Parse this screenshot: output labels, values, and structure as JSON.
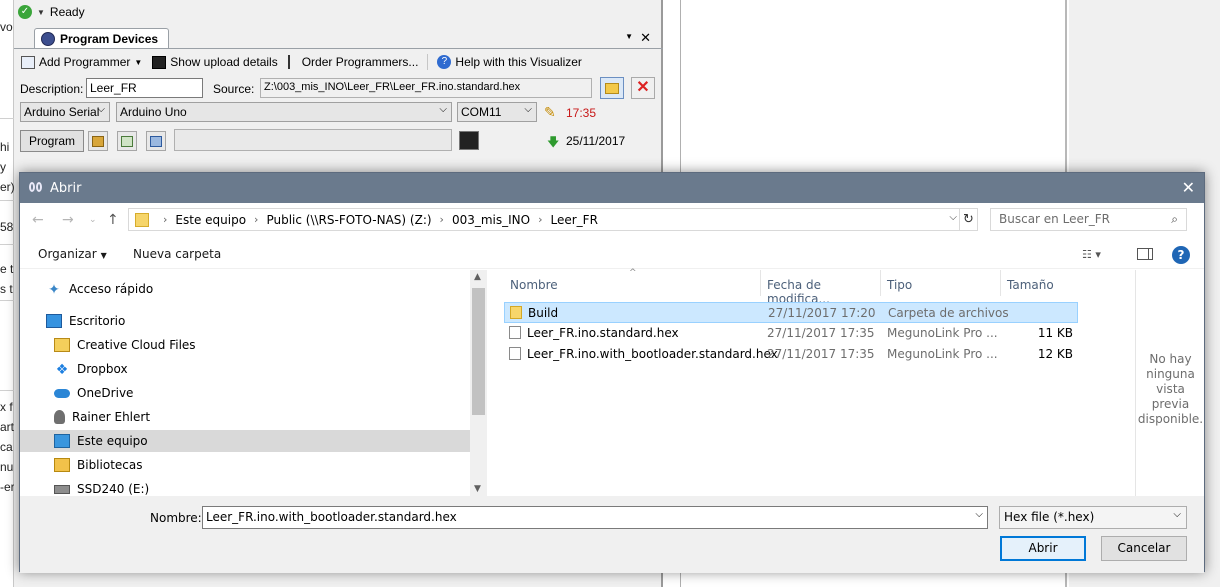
{
  "background": {
    "left_fragments": [
      "vo",
      "hi",
      "y",
      "er)",
      "58",
      "e t",
      "s t",
      "x f",
      "art",
      "ca",
      "nu",
      "-er"
    ],
    "status": "Ready",
    "panel_tab": "Program Devices",
    "toolbar": {
      "add_programmer": "Add Programmer",
      "show_upload": "Show upload details",
      "order_programmers": "Order Programmers...",
      "help": "Help with this Visualizer"
    },
    "description_label": "Description:",
    "description_value": "Leer_FR",
    "source_label": "Source:",
    "source_value": "Z:\\003_mis_INO\\Leer_FR\\Leer_FR.ino.standard.hex",
    "programmer_type": "Arduino Serial",
    "board": "Arduino Uno",
    "port": "COM11",
    "time": "17:35",
    "program_button": "Program",
    "date": "25/11/2017"
  },
  "dialog": {
    "title": "Abrir",
    "breadcrumb": [
      "Este equipo",
      "Public (\\\\RS-FOTO-NAS) (Z:)",
      "003_mis_INO",
      "Leer_FR"
    ],
    "search_placeholder": "Buscar en Leer_FR",
    "organize": "Organizar",
    "new_folder": "Nueva carpeta",
    "nav_items": [
      {
        "label": "Acceso rápido",
        "icon": "star-icon"
      },
      {
        "label": "Escritorio",
        "icon": "desktop-icon"
      },
      {
        "label": "Creative Cloud Files",
        "icon": "creative-cloud-icon"
      },
      {
        "label": "Dropbox",
        "icon": "dropbox-icon"
      },
      {
        "label": "OneDrive",
        "icon": "onedrive-icon"
      },
      {
        "label": "Rainer Ehlert",
        "icon": "user-icon"
      },
      {
        "label": "Este equipo",
        "icon": "computer-icon"
      },
      {
        "label": "Bibliotecas",
        "icon": "libraries-icon"
      },
      {
        "label": "SSD240 (E:)",
        "icon": "drive-icon"
      }
    ],
    "columns": [
      "Nombre",
      "Fecha de modifica...",
      "Tipo",
      "Tamaño"
    ],
    "files": [
      {
        "name": "Build",
        "date": "27/11/2017 17:20",
        "type": "Carpeta de archivos",
        "size": ""
      },
      {
        "name": "Leer_FR.ino.standard.hex",
        "date": "27/11/2017 17:35",
        "type": "MegunoLink Pro ...",
        "size": "11 KB"
      },
      {
        "name": "Leer_FR.ino.with_bootloader.standard.hex",
        "date": "27/11/2017 17:35",
        "type": "MegunoLink Pro ...",
        "size": "12 KB"
      }
    ],
    "preview_text": "No hay ninguna vista previa disponible.",
    "filename_label": "Nombre:",
    "filename_value": "Leer_FR.ino.with_bootloader.standard.hex",
    "filter_value": "Hex file (*.hex)",
    "open_button": "Abrir",
    "cancel_button": "Cancelar"
  }
}
